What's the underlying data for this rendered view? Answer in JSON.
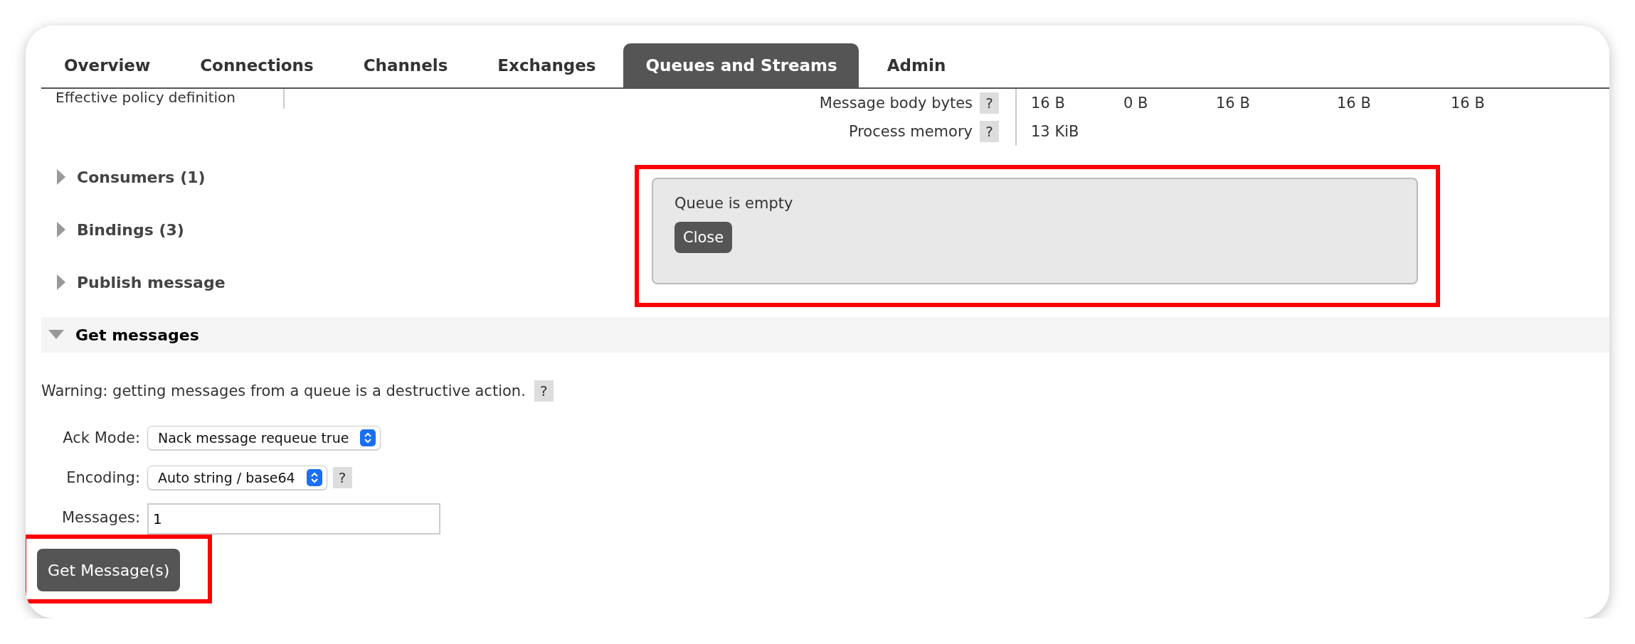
{
  "tabs": [
    {
      "label": "Overview",
      "selected": false
    },
    {
      "label": "Connections",
      "selected": false
    },
    {
      "label": "Channels",
      "selected": false
    },
    {
      "label": "Exchanges",
      "selected": false
    },
    {
      "label": "Queues and Streams",
      "selected": true
    },
    {
      "label": "Admin",
      "selected": false
    }
  ],
  "policy_label": "Effective policy definition",
  "stats": [
    {
      "label": "Message body bytes",
      "help": "?",
      "values": [
        "16 B",
        "0 B",
        "16 B",
        "16 B",
        "16 B"
      ]
    },
    {
      "label": "Process memory",
      "help": "?",
      "values": [
        "13 KiB"
      ]
    }
  ],
  "sections": [
    {
      "title": "Consumers (1)",
      "expanded": false
    },
    {
      "title": "Bindings (3)",
      "expanded": false
    },
    {
      "title": "Publish message",
      "expanded": false
    },
    {
      "title": "Get messages",
      "expanded": true
    }
  ],
  "popup": {
    "message": "Queue is empty",
    "button": "Close",
    "highlighted": true
  },
  "warning": {
    "text": "Warning: getting messages from a queue is a destructive action.",
    "help": "?"
  },
  "fields": [
    {
      "kind": "select",
      "label": "Ack Mode:",
      "value": "Nack message requeue true"
    },
    {
      "kind": "select",
      "label": "Encoding:",
      "value": "Auto string / base64",
      "help": "?"
    },
    {
      "kind": "input",
      "label": "Messages:",
      "value": "1"
    }
  ],
  "submit": {
    "label": "Get Message(s)",
    "highlighted": true
  }
}
